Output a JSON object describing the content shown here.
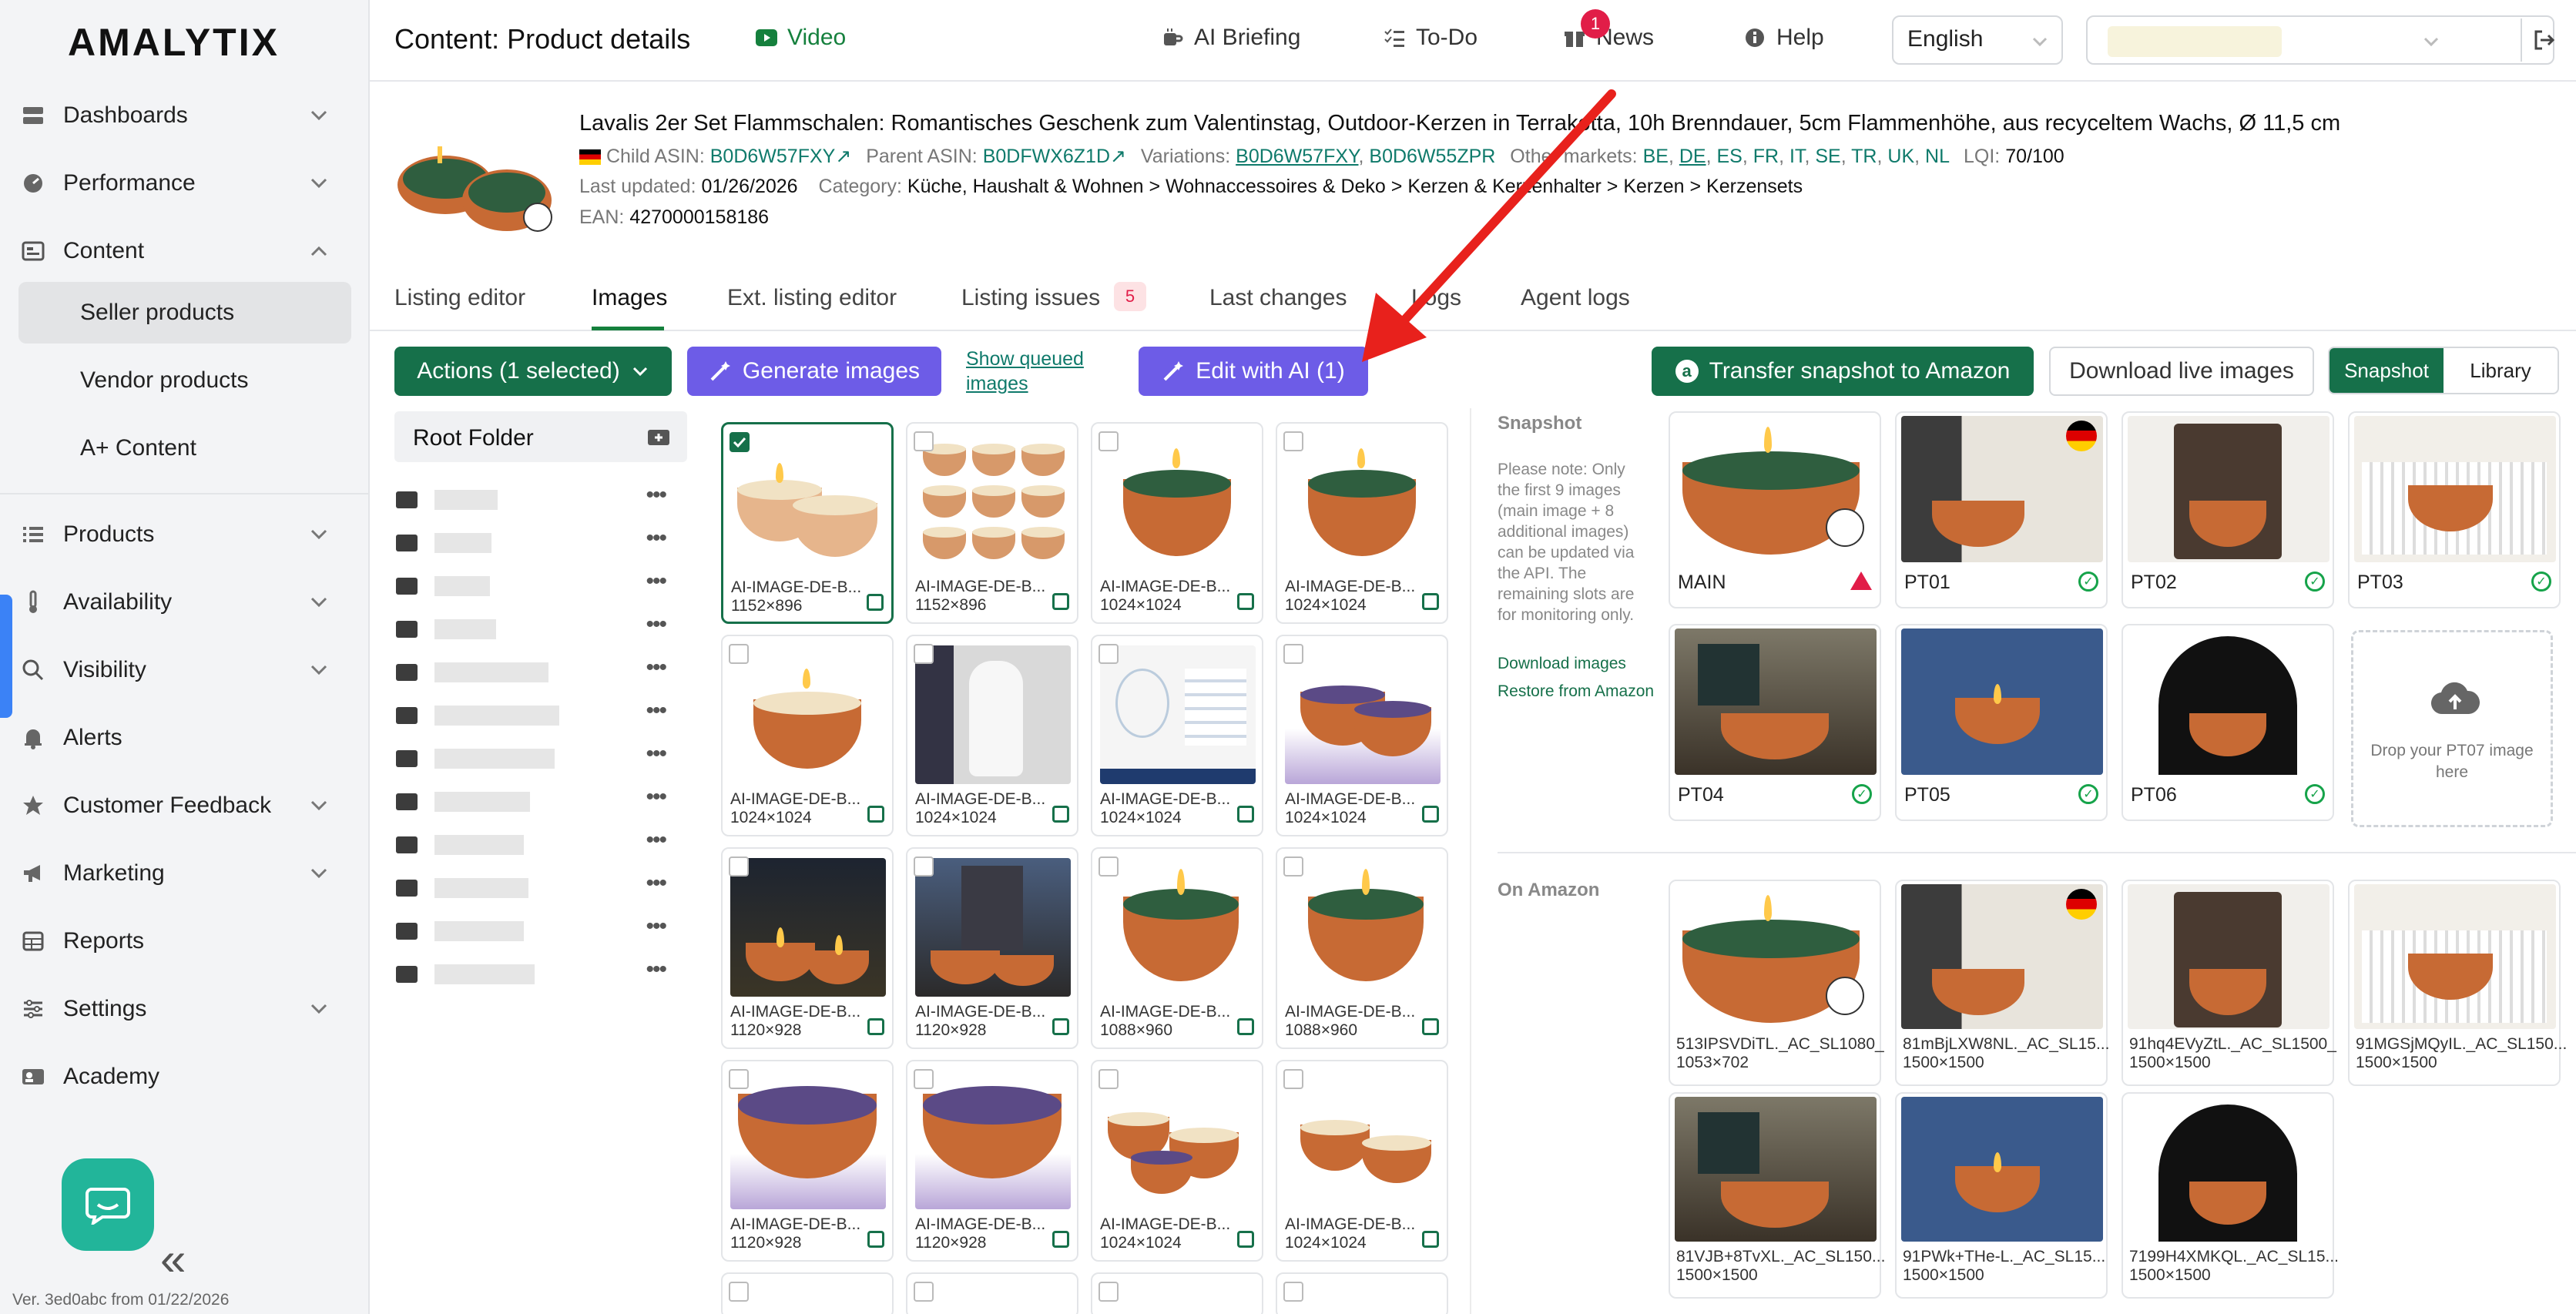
{
  "sidebar": {
    "logo": "AMALYTIX",
    "items": [
      {
        "label": "Dashboards",
        "icon": "dashboard-icon"
      },
      {
        "label": "Performance",
        "icon": "gauge-icon"
      },
      {
        "label": "Content",
        "icon": "content-icon"
      },
      {
        "label": "Seller products"
      },
      {
        "label": "Vendor products"
      },
      {
        "label": "A+ Content"
      },
      {
        "label": "Products",
        "icon": "list-icon"
      },
      {
        "label": "Availability",
        "icon": "thermometer-icon"
      },
      {
        "label": "Visibility",
        "icon": "search-icon"
      },
      {
        "label": "Alerts",
        "icon": "bell-icon"
      },
      {
        "label": "Customer Feedback",
        "icon": "star-icon"
      },
      {
        "label": "Marketing",
        "icon": "megaphone-icon"
      },
      {
        "label": "Reports",
        "icon": "table-icon"
      },
      {
        "label": "Settings",
        "icon": "sliders-icon"
      },
      {
        "label": "Academy",
        "icon": "academy-icon"
      }
    ],
    "version": "Ver. 3ed0abc from 01/22/2026",
    "collapse": "«"
  },
  "header": {
    "title": "Content: Product details",
    "video": "Video",
    "ai_briefing": "AI Briefing",
    "todo": "To-Do",
    "news": "News",
    "news_count": "1",
    "help": "Help",
    "language": "English"
  },
  "product": {
    "title": "Lavalis 2er Set Flammschalen: Romantisches Geschenk zum Valentinstag, Outdoor-Kerzen in Terrakotta, 10h Brenndauer, 5cm Flammenhöhe, aus recyceltem Wachs, Ø 11,5 cm",
    "child_asin_label": "Child ASIN:",
    "child_asin": "B0D6W57FXY",
    "parent_asin_label": "Parent ASIN:",
    "parent_asin": "B0DFWX6Z1D",
    "variations_label": "Variations:",
    "variation_1": "B0D6W57FXY",
    "variation_2": "B0D6W55ZPR",
    "other_markets_label": "Other markets:",
    "markets": [
      "BE",
      "DE",
      "ES",
      "FR",
      "IT",
      "SE",
      "TR",
      "UK",
      "NL"
    ],
    "lqi_label": "LQI:",
    "lqi": "70/100",
    "last_updated_label": "Last updated:",
    "last_updated": "01/26/2026",
    "category_label": "Category:",
    "category": "Küche, Haushalt & Wohnen > Wohnaccessoires & Deko > Kerzen & Kerzenhalter > Kerzen > Kerzensets",
    "ean_label": "EAN:",
    "ean": "4270000158186"
  },
  "tabs": [
    {
      "label": "Listing editor"
    },
    {
      "label": "Images"
    },
    {
      "label": "Ext. listing editor"
    },
    {
      "label": "Listing issues",
      "badge": "5"
    },
    {
      "label": "Last changes"
    },
    {
      "label": "Logs"
    },
    {
      "label": "Agent logs"
    }
  ],
  "toolbar": {
    "actions": "Actions (1 selected)",
    "generate": "Generate images",
    "show_queued": "Show queued images",
    "edit_ai": "Edit with AI (1)",
    "transfer": "Transfer snapshot to Amazon",
    "download_live": "Download live images",
    "snapshot": "Snapshot",
    "library": "Library"
  },
  "folders": {
    "root": "Root Folder"
  },
  "grid": [
    {
      "name": "AI-IMAGE-DE-B...",
      "dim": "1152×896"
    },
    {
      "name": "AI-IMAGE-DE-B...",
      "dim": "1152×896"
    },
    {
      "name": "AI-IMAGE-DE-B...",
      "dim": "1024×1024"
    },
    {
      "name": "AI-IMAGE-DE-B...",
      "dim": "1024×1024"
    },
    {
      "name": "AI-IMAGE-DE-B...",
      "dim": "1024×1024"
    },
    {
      "name": "AI-IMAGE-DE-B...",
      "dim": "1024×1024"
    },
    {
      "name": "AI-IMAGE-DE-B...",
      "dim": "1024×1024"
    },
    {
      "name": "AI-IMAGE-DE-B...",
      "dim": "1024×1024"
    },
    {
      "name": "AI-IMAGE-DE-B...",
      "dim": "1120×928"
    },
    {
      "name": "AI-IMAGE-DE-B...",
      "dim": "1120×928"
    },
    {
      "name": "AI-IMAGE-DE-B...",
      "dim": "1088×960"
    },
    {
      "name": "AI-IMAGE-DE-B...",
      "dim": "1088×960"
    },
    {
      "name": "AI-IMAGE-DE-B...",
      "dim": "1120×928"
    },
    {
      "name": "AI-IMAGE-DE-B...",
      "dim": "1120×928"
    },
    {
      "name": "AI-IMAGE-DE-B...",
      "dim": "1024×1024"
    },
    {
      "name": "AI-IMAGE-DE-B...",
      "dim": "1024×1024"
    }
  ],
  "snapshot": {
    "label": "Snapshot",
    "note": "Please note: Only the first 9 images (main image + 8 additional images) can be updated via the API. The remaining slots are for monitoring only.",
    "download": "Download images",
    "restore": "Restore from Amazon",
    "slots": [
      {
        "label": "MAIN",
        "status": "warning"
      },
      {
        "label": "PT01",
        "status": "ok"
      },
      {
        "label": "PT02",
        "status": "ok"
      },
      {
        "label": "PT03",
        "status": "ok"
      },
      {
        "label": "PT04",
        "status": "ok"
      },
      {
        "label": "PT05",
        "status": "ok"
      },
      {
        "label": "PT06",
        "status": "ok"
      }
    ],
    "drop": "Drop your PT07 image here"
  },
  "on_amazon": {
    "label": "On Amazon",
    "images": [
      {
        "name": "513IPSVDiTL._AC_SL1080_",
        "dim": "1053×702"
      },
      {
        "name": "81mBjLXW8NL._AC_SL15...",
        "dim": "1500×1500"
      },
      {
        "name": "91hq4EVyZtL._AC_SL1500_",
        "dim": "1500×1500"
      },
      {
        "name": "91MGSjMQyIL._AC_SL150...",
        "dim": "1500×1500"
      },
      {
        "name": "81VJB+8TvXL._AC_SL150...",
        "dim": "1500×1500"
      },
      {
        "name": "91PWk+THe-L._AC_SL15...",
        "dim": "1500×1500"
      },
      {
        "name": "7199H4XMKQL._AC_SL15...",
        "dim": "1500×1500"
      }
    ]
  },
  "colors": {
    "brand_green": "#16704a",
    "ai_purple": "#6d5ce7",
    "arrow_red": "#e8211c"
  }
}
